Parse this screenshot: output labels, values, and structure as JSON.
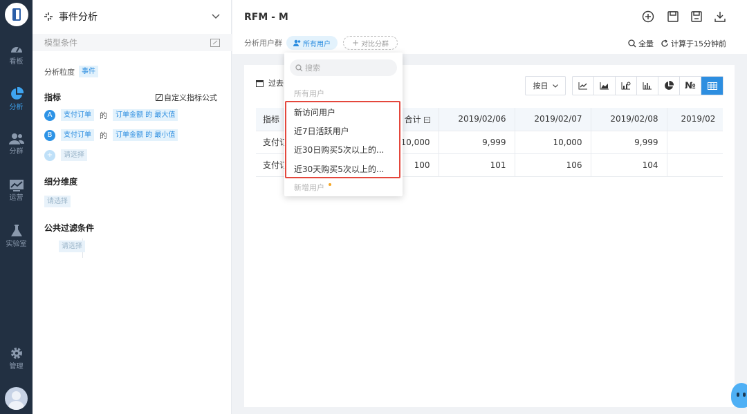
{
  "nav": {
    "items": [
      {
        "label": "看板",
        "icon": "dashboard-icon"
      },
      {
        "label": "分析",
        "icon": "pie-chart-icon",
        "active": true
      },
      {
        "label": "分群",
        "icon": "users-icon"
      },
      {
        "label": "运营",
        "icon": "operation-icon"
      },
      {
        "label": "实验室",
        "icon": "flask-icon"
      }
    ],
    "bottom": {
      "label": "管理",
      "icon": "gear-icon"
    }
  },
  "panel": {
    "title": "事件分析",
    "model_conditions": "模型条件",
    "granularity_label": "分析粒度",
    "granularity_value": "事件",
    "metrics_title": "指标",
    "custom_formula": "自定义指标公式",
    "metrics": [
      {
        "badge": "A",
        "event": "支付订单",
        "de": "的",
        "property": "订单金额 的 最大值"
      },
      {
        "badge": "B",
        "event": "支付订单",
        "de": "的",
        "property": "订单金额 的 最小值"
      }
    ],
    "add_placeholder": "请选择",
    "breakdown_title": "细分维度",
    "breakdown_placeholder": "请选择",
    "filter_title": "公共过滤条件",
    "filter_placeholder": "请选择"
  },
  "main": {
    "title": "RFM - M",
    "group_label": "分析用户群",
    "group_value": "所有用户",
    "compare_label": "对比分群",
    "full_label": "全量",
    "calc_label": "计算于15分钟前",
    "date_label": "过去",
    "day_select": "按日",
    "chart_types": [
      "line-chart-icon",
      "area-chart-icon",
      "bar-line-icon",
      "bar-chart-icon",
      "pie-chart-icon",
      "number-icon",
      "table-icon"
    ]
  },
  "table": {
    "headers": [
      "指标",
      "合计",
      "2019/02/06",
      "2019/02/07",
      "2019/02/08",
      "2019/02"
    ],
    "rows": [
      [
        "支付订",
        "10,000",
        "9,999",
        "10,000",
        "9,999",
        ""
      ],
      [
        "支付订",
        "100",
        "101",
        "106",
        "104",
        ""
      ]
    ]
  },
  "dropdown": {
    "search_placeholder": "搜索",
    "current": "所有用户",
    "items": [
      "新访问用户",
      "近7日活跃用户",
      "近30日购买5次以上的...",
      "近30天购买5次以上的..."
    ],
    "new_group": "新增用户"
  },
  "colors": {
    "accent": "#2d8ee0",
    "highlight": "#e4473c",
    "nav_bg": "#223042"
  }
}
